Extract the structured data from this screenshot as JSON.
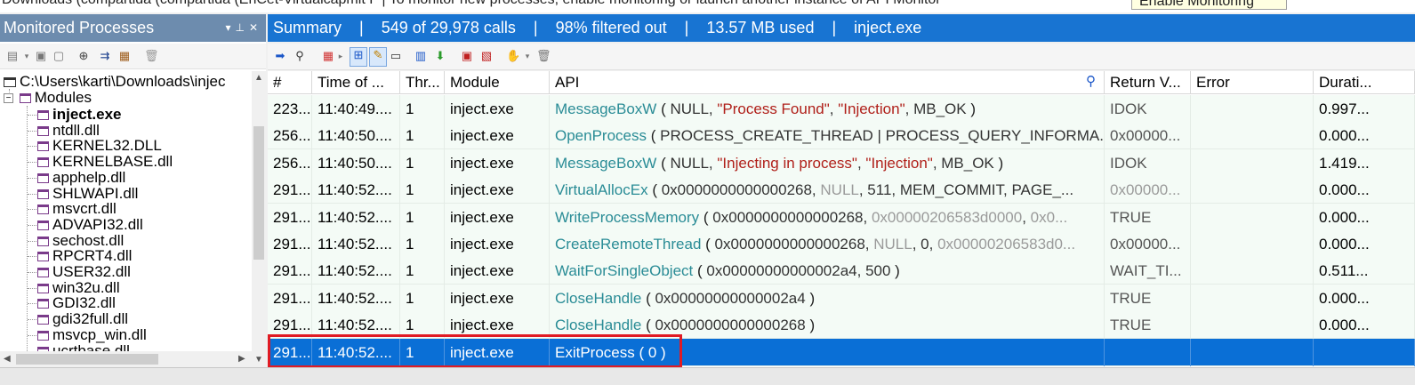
{
  "topbar": {
    "text": "Downloads (compartida (compartida (EnCet-Virtualcapmit F | To monitor new processes, enable monitoring or launch another instance of API Monitor",
    "enable_button": "Enable Monitoring"
  },
  "left_panel": {
    "title": "Monitored Processes",
    "root": "C:\\Users\\karti\\Downloads\\injec",
    "modules_label": "Modules",
    "modules": [
      "inject.exe",
      "ntdll.dll",
      "KERNEL32.DLL",
      "KERNELBASE.dll",
      "apphelp.dll",
      "SHLWAPI.dll",
      "msvcrt.dll",
      "ADVAPI32.dll",
      "sechost.dll",
      "RPCRT4.dll",
      "USER32.dll",
      "win32u.dll",
      "GDI32.dll",
      "gdi32full.dll",
      "msvcp_win.dll",
      "ucrtbase.dll"
    ]
  },
  "summary": {
    "label": "Summary",
    "calls": "549 of 29,978 calls",
    "filtered": "98% filtered out",
    "memory": "13.57 MB used",
    "process": "inject.exe",
    "separator": "|"
  },
  "grid": {
    "columns": [
      "#",
      "Time of ...",
      "Thr...",
      "Module",
      "API",
      "Return V...",
      "Error",
      "Durati..."
    ],
    "rows": [
      {
        "num": "223...",
        "time": "11:40:49....",
        "thread": "1",
        "module": "inject.exe",
        "api": "MessageBoxW",
        "args": [
          [
            "(",
            "punc"
          ],
          [
            " NULL, ",
            "argtxt"
          ],
          [
            "\"Process Found\"",
            "argstr"
          ],
          [
            ", ",
            "argtxt"
          ],
          [
            "\"Injection\"",
            "argstr"
          ],
          [
            ", MB_OK ",
            "argtxt"
          ],
          [
            ")",
            "punc"
          ]
        ],
        "ret": "IDOK",
        "ret_gray": false,
        "error": "",
        "duration": "0.997..."
      },
      {
        "num": "256...",
        "time": "11:40:50....",
        "thread": "1",
        "module": "inject.exe",
        "api": "OpenProcess",
        "args": [
          [
            "(",
            "punc"
          ],
          [
            " PROCESS_CREATE_THREAD | PROCESS_QUERY_INFORMA...",
            "argtxt"
          ]
        ],
        "ret": "0x00000...",
        "ret_gray": false,
        "error": "",
        "duration": "0.000..."
      },
      {
        "num": "256...",
        "time": "11:40:50....",
        "thread": "1",
        "module": "inject.exe",
        "api": "MessageBoxW",
        "args": [
          [
            "(",
            "punc"
          ],
          [
            " NULL, ",
            "argtxt"
          ],
          [
            "\"Injecting in process\"",
            "argstr"
          ],
          [
            ", ",
            "argtxt"
          ],
          [
            "\"Injection\"",
            "argstr"
          ],
          [
            ", MB_OK ",
            "argtxt"
          ],
          [
            ")",
            "punc"
          ]
        ],
        "ret": "IDOK",
        "ret_gray": false,
        "error": "",
        "duration": "1.419..."
      },
      {
        "num": "291...",
        "time": "11:40:52....",
        "thread": "1",
        "module": "inject.exe",
        "api": "VirtualAllocEx",
        "args": [
          [
            "(",
            "punc"
          ],
          [
            " 0x0000000000000268, ",
            "argtxt"
          ],
          [
            "NULL",
            "arggray"
          ],
          [
            ", 511, MEM_COMMIT, PAGE_...",
            "argtxt"
          ]
        ],
        "ret": "0x00000...",
        "ret_gray": true,
        "error": "",
        "duration": "0.000..."
      },
      {
        "num": "291...",
        "time": "11:40:52....",
        "thread": "1",
        "module": "inject.exe",
        "api": "WriteProcessMemory",
        "args": [
          [
            "(",
            "punc"
          ],
          [
            " 0x0000000000000268, ",
            "argtxt"
          ],
          [
            "0x00000206583d0000",
            "arggray"
          ],
          [
            ", ",
            "argtxt"
          ],
          [
            "0x0...",
            "arggray"
          ]
        ],
        "ret": "TRUE",
        "ret_gray": false,
        "error": "",
        "duration": "0.000..."
      },
      {
        "num": "291...",
        "time": "11:40:52....",
        "thread": "1",
        "module": "inject.exe",
        "api": "CreateRemoteThread",
        "args": [
          [
            "(",
            "punc"
          ],
          [
            " 0x0000000000000268, ",
            "argtxt"
          ],
          [
            "NULL",
            "arggray"
          ],
          [
            ", 0, ",
            "argtxt"
          ],
          [
            "0x00000206583d0...",
            "arggray"
          ]
        ],
        "ret": "0x00000...",
        "ret_gray": false,
        "error": "",
        "duration": "0.000..."
      },
      {
        "num": "291...",
        "time": "11:40:52....",
        "thread": "1",
        "module": "inject.exe",
        "api": "WaitForSingleObject",
        "args": [
          [
            "(",
            "punc"
          ],
          [
            " 0x00000000000002a4, 500 ",
            "argtxt"
          ],
          [
            ")",
            "punc"
          ]
        ],
        "ret": "WAIT_TI...",
        "ret_gray": false,
        "error": "",
        "duration": "0.511..."
      },
      {
        "num": "291...",
        "time": "11:40:52....",
        "thread": "1",
        "module": "inject.exe",
        "api": "CloseHandle",
        "args": [
          [
            "(",
            "punc"
          ],
          [
            " 0x00000000000002a4 ",
            "argtxt"
          ],
          [
            ")",
            "punc"
          ]
        ],
        "ret": "TRUE",
        "ret_gray": false,
        "error": "",
        "duration": "0.000..."
      },
      {
        "num": "291...",
        "time": "11:40:52....",
        "thread": "1",
        "module": "inject.exe",
        "api": "CloseHandle",
        "args": [
          [
            "(",
            "punc"
          ],
          [
            " 0x0000000000000268 ",
            "argtxt"
          ],
          [
            ")",
            "punc"
          ]
        ],
        "ret": "TRUE",
        "ret_gray": false,
        "error": "",
        "duration": "0.000..."
      },
      {
        "num": "291...",
        "time": "11:40:52....",
        "thread": "1",
        "module": "inject.exe",
        "api": "ExitProcess",
        "args": [
          [
            "( 0 )",
            "argtxt"
          ]
        ],
        "ret": "",
        "ret_gray": false,
        "error": "",
        "duration": "",
        "selected": true
      }
    ]
  },
  "colors": {
    "summary_bar": "#1874d2",
    "left_header": "#6d8cae",
    "api_name": "#2a8c96",
    "string_arg": "#b0201a",
    "selection": "#0a6fd6",
    "highlight_box": "#e01b24"
  }
}
